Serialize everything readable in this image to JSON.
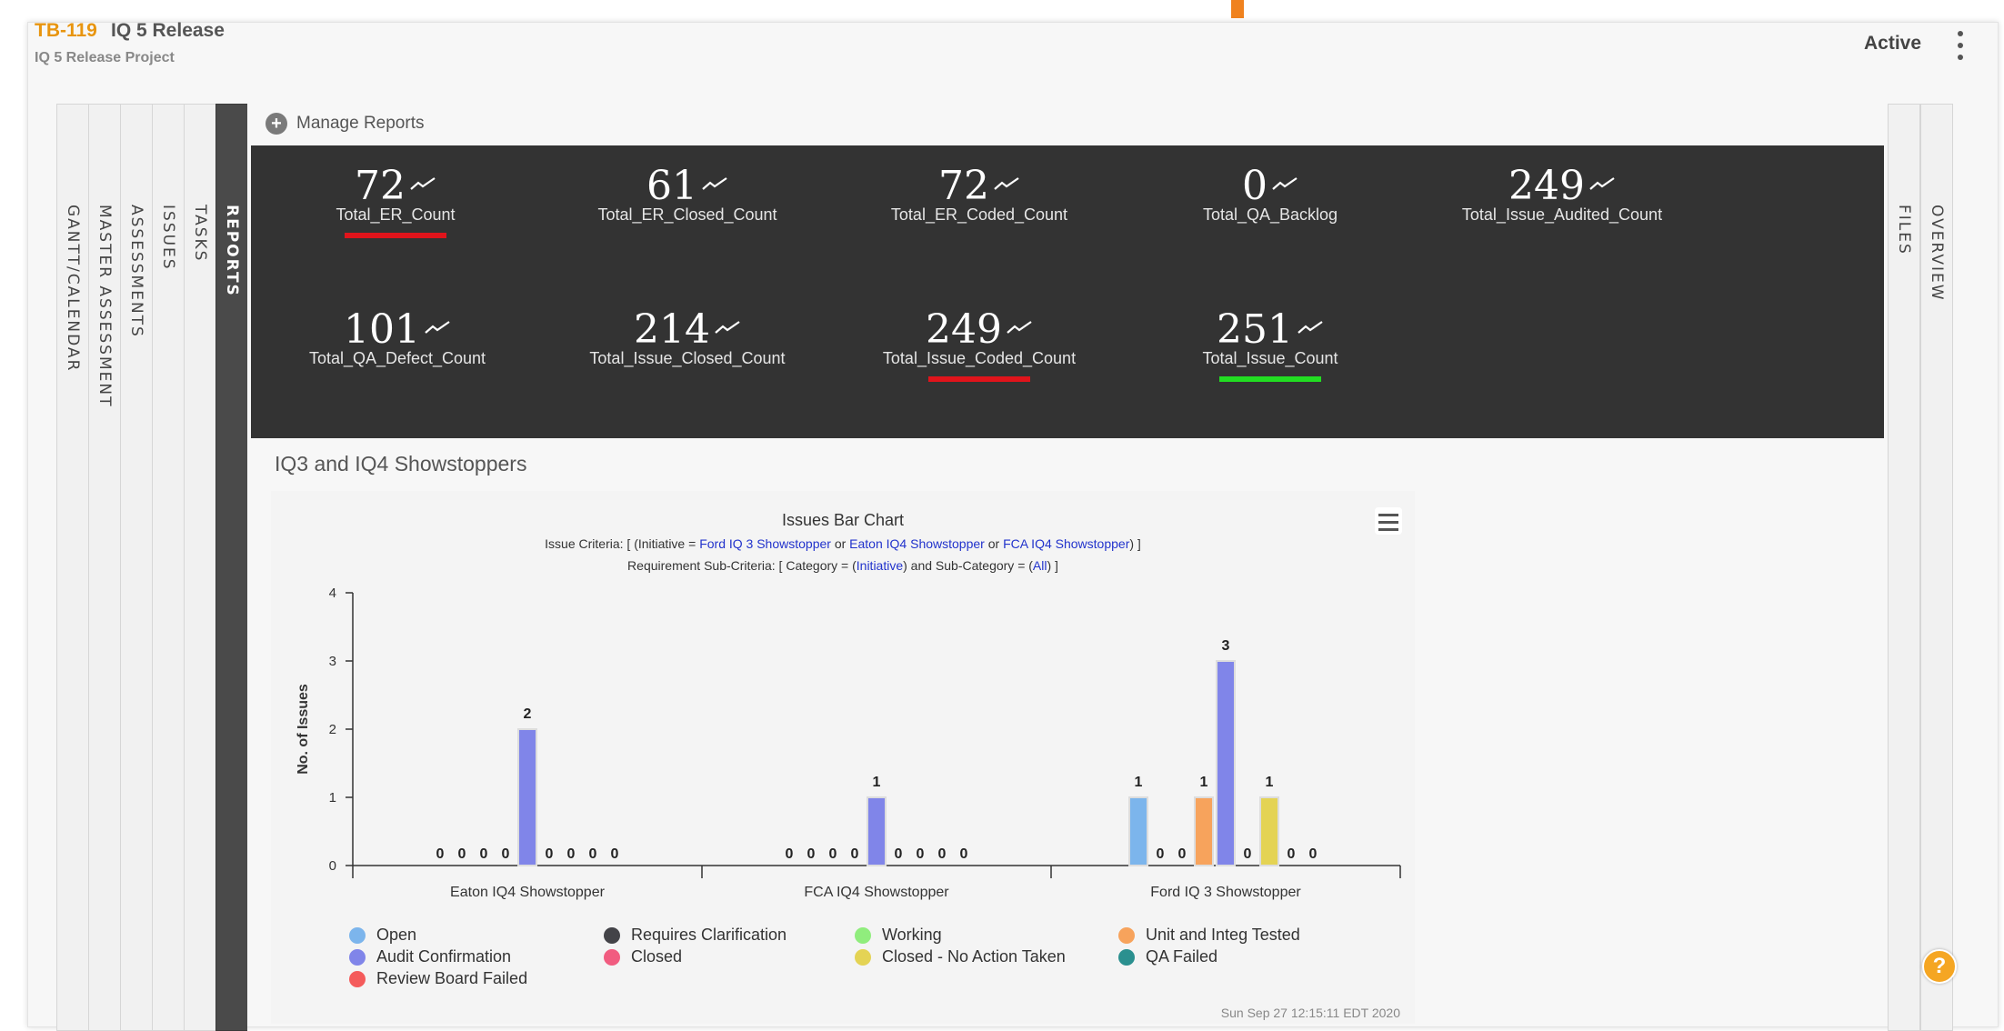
{
  "header": {
    "id": "TB-119",
    "title": "IQ 5 Release",
    "subtitle": "IQ 5 Release Project",
    "status": "Active"
  },
  "left_tabs": [
    {
      "label": "GANTT/CALENDAR",
      "active": false
    },
    {
      "label": "MASTER ASSESSMENT",
      "active": false
    },
    {
      "label": "ASSESSMENTS",
      "active": false
    },
    {
      "label": "ISSUES",
      "active": false
    },
    {
      "label": "TASKS",
      "active": false
    },
    {
      "label": "REPORTS",
      "active": true
    }
  ],
  "right_tabs": [
    {
      "label": "FILES"
    },
    {
      "label": "OVERVIEW"
    }
  ],
  "manage_reports": "Manage Reports",
  "kpis": [
    {
      "value": "72",
      "label": "Total_ER_Count",
      "underline": "#e0141b"
    },
    {
      "value": "61",
      "label": "Total_ER_Closed_Count",
      "underline": null
    },
    {
      "value": "72",
      "label": "Total_ER_Coded_Count",
      "underline": null
    },
    {
      "value": "0",
      "label": "Total_QA_Backlog",
      "underline": null
    },
    {
      "value": "249",
      "label": "Total_Issue_Audited_Count",
      "underline": null
    },
    {
      "value": "101",
      "label": "Total_QA_Defect_Count",
      "underline": null
    },
    {
      "value": "214",
      "label": "Total_Issue_Closed_Count",
      "underline": null
    },
    {
      "value": "249",
      "label": "Total_Issue_Coded_Count",
      "underline": "#e0141b"
    },
    {
      "value": "251",
      "label": "Total_Issue_Count",
      "underline": "#22dd22"
    }
  ],
  "section_title": "IQ3 and IQ4 Showstoppers",
  "chart_header": {
    "sub1_pre": "Issue Criteria: [ (Initiative = ",
    "sub1_a": "Ford IQ 3 Showstopper",
    "sub1_or1": " or ",
    "sub1_b": "Eaton IQ4 Showstopper",
    "sub1_or2": " or ",
    "sub1_c": "FCA IQ4 Showstopper",
    "sub1_post": ") ]",
    "sub2_pre": "Requirement Sub-Criteria: [ Category = (",
    "sub2_a": "Initiative",
    "sub2_mid": ") and Sub-Category = (",
    "sub2_b": "All",
    "sub2_post": ") ]",
    "timestamp": "Sun Sep 27 12:15:11 EDT 2020"
  },
  "chart_data": {
    "type": "bar",
    "title": "Issues Bar Chart",
    "ylabel": "No. of Issues",
    "xlabel": "",
    "ylim": [
      0,
      4
    ],
    "yticks": [
      0,
      1,
      2,
      3,
      4
    ],
    "grid": false,
    "legend_position": "bottom",
    "categories": [
      "Eaton IQ4 Showstopper",
      "FCA IQ4 Showstopper",
      "Ford IQ 3 Showstopper"
    ],
    "series": [
      {
        "name": "Open",
        "color": "#7cb5ec",
        "values": [
          0,
          0,
          1
        ]
      },
      {
        "name": "Requires Clarification",
        "color": "#434348",
        "values": [
          0,
          0,
          0
        ]
      },
      {
        "name": "Working",
        "color": "#90ed7d",
        "values": [
          0,
          0,
          0
        ]
      },
      {
        "name": "Unit and Integ Tested",
        "color": "#f7a35c",
        "values": [
          0,
          0,
          1
        ]
      },
      {
        "name": "Audit Confirmation",
        "color": "#8085e9",
        "values": [
          2,
          1,
          3
        ]
      },
      {
        "name": "Closed",
        "color": "#f15c80",
        "values": [
          0,
          0,
          0
        ]
      },
      {
        "name": "Closed - No Action Taken",
        "color": "#e4d354",
        "values": [
          0,
          0,
          1
        ]
      },
      {
        "name": "QA Failed",
        "color": "#2b908f",
        "values": [
          0,
          0,
          0
        ]
      },
      {
        "name": "Review Board Failed",
        "color": "#f45b5b",
        "values": [
          0,
          0,
          0
        ]
      }
    ]
  }
}
